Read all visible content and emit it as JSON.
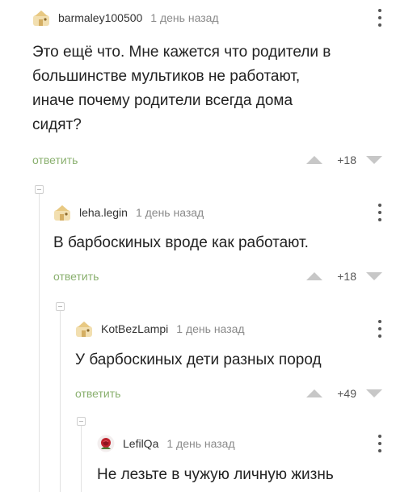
{
  "comments": [
    {
      "author": "barmaley100500",
      "time": "1 день назад",
      "lines": [
        "Это ещё что. Мне кажется что родители в",
        "большинстве мультиков не работают,",
        "иначе почему родители всегда дома",
        "сидят?"
      ],
      "reply_label": "ответить",
      "score": "+18"
    },
    {
      "author": "leha.legin",
      "time": "1 день назад",
      "lines": [
        "В барбоскиных вроде как работают."
      ],
      "reply_label": "ответить",
      "score": "+18"
    },
    {
      "author": "KotBezLampi",
      "time": "1 день назад",
      "lines": [
        "У барбоскиных дети разных пород"
      ],
      "reply_label": "ответить",
      "score": "+49"
    },
    {
      "author": "LefilQa",
      "time": "1 день назад",
      "lines": [
        "Не лезьте в чужую личную жизнь"
      ]
    }
  ],
  "colors": {
    "reply_link": "#8ab06f",
    "vote_arrow": "#c7c7c7",
    "tree_line": "#e2e2e2",
    "muted_text": "#8a8a8a"
  },
  "icons": [
    "default-avatar-icon",
    "rose-avatar-icon",
    "more-dots-icon",
    "upvote-arrow-icon",
    "downvote-arrow-icon",
    "collapse-toggle-icon"
  ]
}
